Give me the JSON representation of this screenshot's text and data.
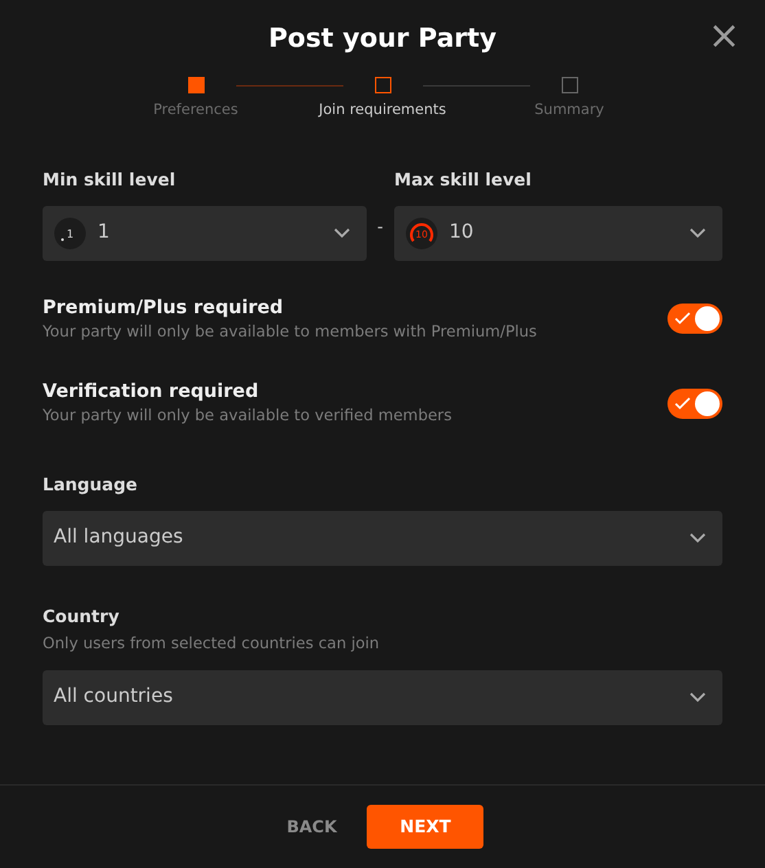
{
  "dialog": {
    "title": "Post your Party",
    "close": "×"
  },
  "steps": [
    {
      "label": "Preferences",
      "completed": true,
      "selected": false
    },
    {
      "label": "Join requirements",
      "completed": false,
      "selected": true
    },
    {
      "label": "Summary",
      "completed": false,
      "selected": false
    }
  ],
  "skill": {
    "separator": "-",
    "selects": [
      {
        "label": "Min skill level",
        "value": "1",
        "icon_text": "1",
        "color": "#d9d9d9"
      },
      {
        "label": "Max skill level",
        "value": "10",
        "icon_text": "10",
        "color": "#ff2a00"
      }
    ]
  },
  "toggles": [
    {
      "title": "Premium/Plus required",
      "description": "Your party will only be available to members with Premium/Plus",
      "on": true
    },
    {
      "title": "Verification required",
      "description": "Your party will only be available to verified members",
      "on": true
    }
  ],
  "language": {
    "label": "Language",
    "value": "All languages"
  },
  "country": {
    "label": "Country",
    "description": "Only users from selected countries can join",
    "value": "All countries"
  },
  "footer": {
    "back": "BACK",
    "next": "NEXT"
  }
}
